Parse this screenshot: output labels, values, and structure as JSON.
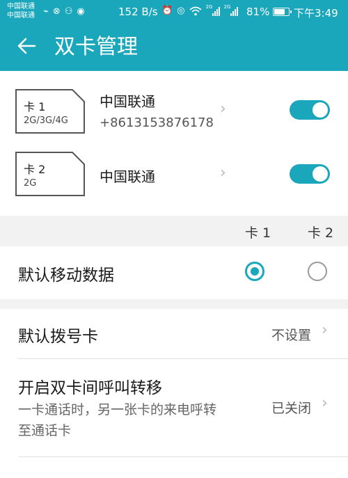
{
  "status_bar": {
    "carrier_1": "中国联通",
    "carrier_2": "中国联通",
    "speed": "152 B/s",
    "sim1_label": "2G",
    "sim2_label": "2G",
    "battery_percent_text": "81%",
    "battery_level": 0.81,
    "time": "下午3:49"
  },
  "app_bar": {
    "title": "双卡管理"
  },
  "sims": [
    {
      "name": "卡 1",
      "network": "2G/3G/4G",
      "carrier": "中国联通",
      "number": "+8613153876178",
      "enabled": true
    },
    {
      "name": "卡 2",
      "network": "2G",
      "carrier": "中国联通",
      "number": "",
      "enabled": true
    }
  ],
  "columns": {
    "card1": "卡 1",
    "card2": "卡 2"
  },
  "default_data": {
    "label": "默认移动数据",
    "selected": "card1"
  },
  "default_dial": {
    "label": "默认拨号卡",
    "value": "不设置"
  },
  "call_forward": {
    "label": "开启双卡间呼叫转移",
    "description": "一卡通话时，另一张卡的来电呼转至通话卡",
    "value": "已关闭"
  },
  "colors": {
    "accent": "#1aa7bb",
    "band": "#f2f2f2"
  },
  "icons": {
    "back": "arrow-left-icon",
    "chevron": "chevron-right-icon"
  }
}
